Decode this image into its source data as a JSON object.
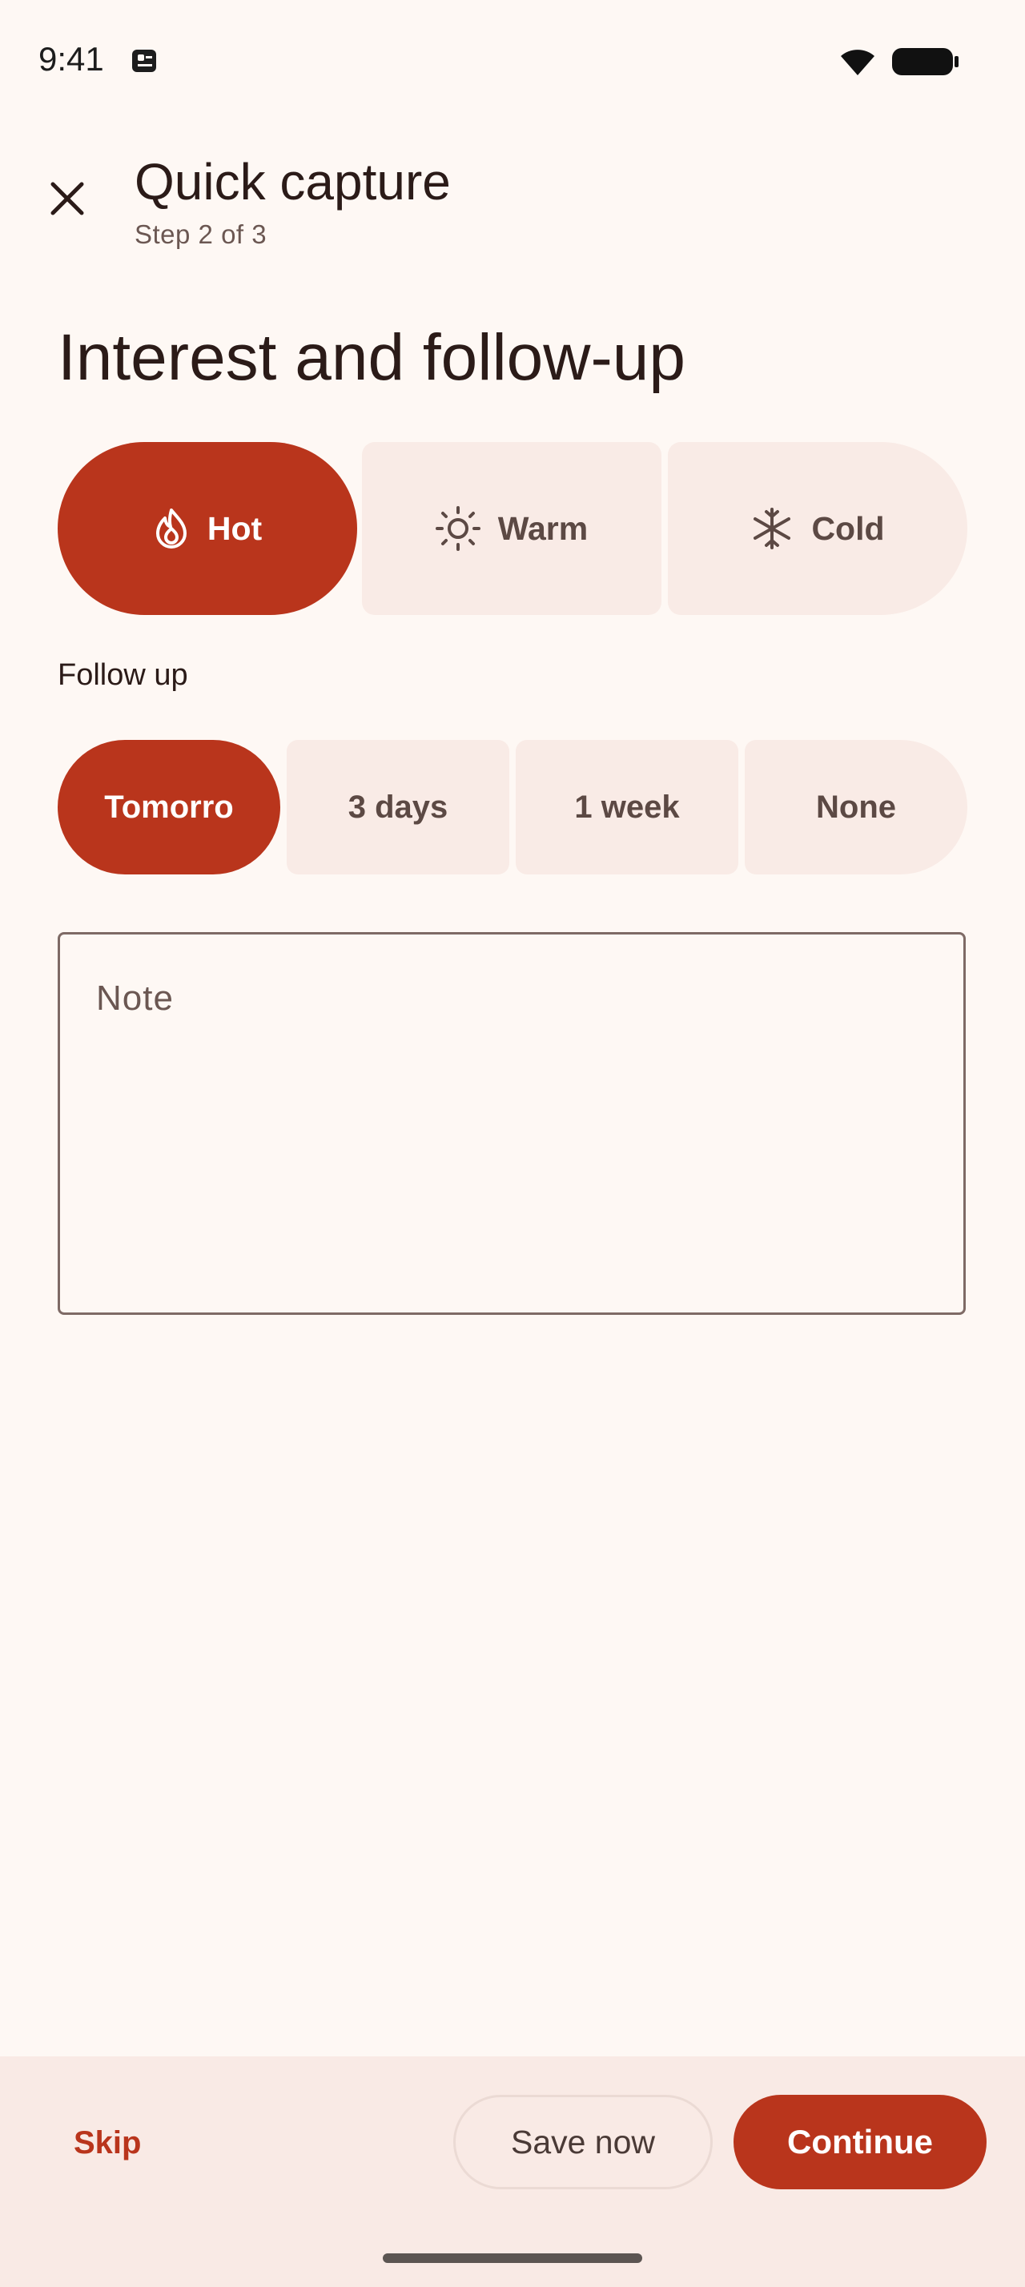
{
  "status_bar": {
    "time": "9:41",
    "app_icon": "notification-app-icon",
    "wifi_icon": "wifi-icon",
    "battery_icon": "battery-icon"
  },
  "header": {
    "close_icon": "close-icon",
    "title": "Quick capture",
    "subtitle": "Step 2 of 3"
  },
  "heading": "Interest and follow-up",
  "interest": {
    "options": [
      {
        "label": "Hot",
        "icon": "flame-icon",
        "selected": true
      },
      {
        "label": "Warm",
        "icon": "sun-icon",
        "selected": false
      },
      {
        "label": "Cold",
        "icon": "snowflake-icon",
        "selected": false
      }
    ]
  },
  "follow_up": {
    "label": "Follow up",
    "options": [
      {
        "label": "Tomorro",
        "selected": true
      },
      {
        "label": "3 days",
        "selected": false
      },
      {
        "label": "1 week",
        "selected": false
      },
      {
        "label": "None",
        "selected": false
      }
    ]
  },
  "note": {
    "placeholder": "Note",
    "value": ""
  },
  "actions": {
    "skip": "Skip",
    "save_now": "Save now",
    "continue": "Continue"
  },
  "colors": {
    "accent": "#B9351C",
    "background": "#FEF8F4",
    "unselected_chip": "#F9EBE6",
    "bottom_bar": "#F9EAE5"
  }
}
